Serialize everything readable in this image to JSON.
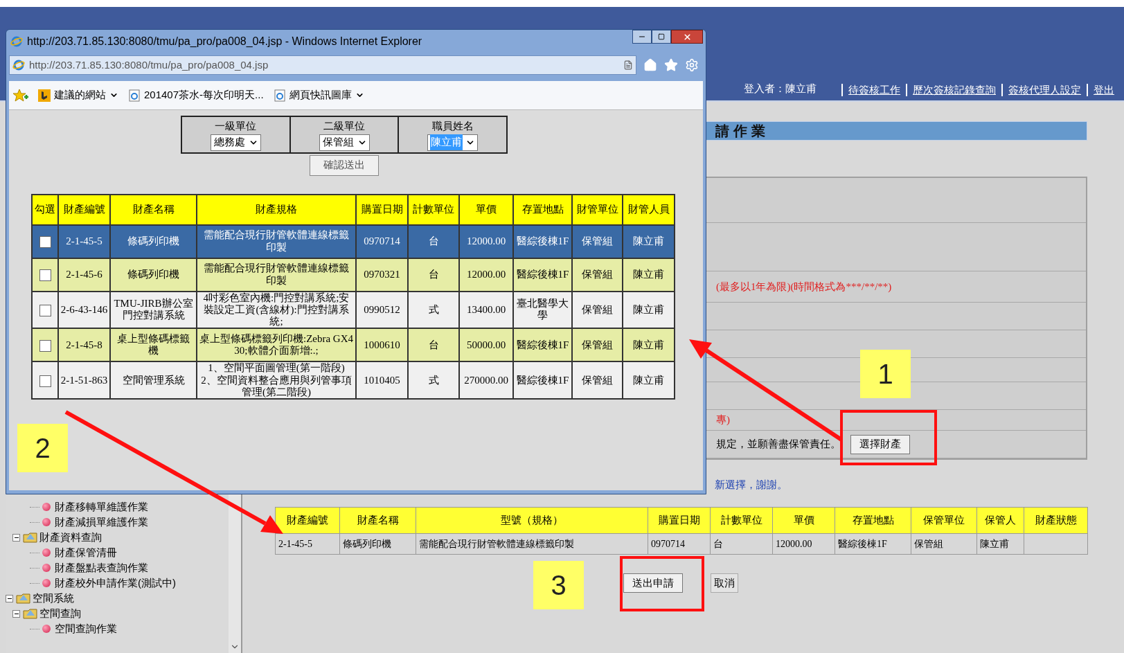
{
  "header": {
    "user_label": "登入者：陳立甫",
    "links": [
      "待簽核工作",
      "歷次簽核記錄查詢",
      "簽核代理人設定",
      "登出"
    ]
  },
  "page_title": "請作業",
  "form_rows": [
    {
      "kind": "blank"
    },
    {
      "kind": "blank"
    },
    {
      "kind": "note",
      "text": "(最多以1年為限)(時間格式為***/**/**)"
    },
    {
      "kind": "blank"
    },
    {
      "kind": "blank"
    },
    {
      "kind": "blank"
    },
    {
      "kind": "blank"
    },
    {
      "kind": "note",
      "text": "專)"
    },
    {
      "kind": "action",
      "text": "規定，並願善盡保管責任。",
      "button": "選擇財產"
    }
  ],
  "notice": "新選擇，謝謝。",
  "selected_table": {
    "columns": [
      "財產編號",
      "財產名稱",
      "型號（規格）",
      "購置日期",
      "計數單位",
      "單價",
      "存置地點",
      "保管單位",
      "保管人",
      "財產狀態"
    ],
    "rows": [
      [
        "2-1-45-5",
        "條碼列印機",
        "需能配合現行財管軟體連線標籤印製",
        "0970714",
        "台",
        "12000.00",
        "醫綜後棟1F",
        "保管組",
        "陳立甫",
        ""
      ]
    ]
  },
  "actions": [
    "送出申請",
    "取消"
  ],
  "sidebar": {
    "tree": [
      {
        "kind": "group",
        "children": [
          {
            "kind": "group",
            "children": [
              {
                "kind": "leaf",
                "label": "財產移轉單維護作業"
              },
              {
                "kind": "leaf",
                "label": "財產減損單維護作業"
              }
            ]
          },
          {
            "kind": "folder",
            "label": "財產資料查詢",
            "expanded": true,
            "children": [
              {
                "kind": "leaf",
                "label": "財產保管清冊"
              },
              {
                "kind": "leaf",
                "label": "財產盤點表查詢作業"
              },
              {
                "kind": "leaf",
                "label": "財產校外申請作業(測試中)"
              }
            ]
          }
        ]
      },
      {
        "kind": "folder",
        "label": "空間系統",
        "expanded": true,
        "children": [
          {
            "kind": "folder",
            "label": "空間查詢",
            "expanded": true,
            "children": [
              {
                "kind": "leaf",
                "label": "空間查詢作業"
              }
            ]
          }
        ]
      }
    ]
  },
  "popup": {
    "title": "http://203.71.85.130:8080/tmu/pa_pro/pa008_04.jsp - Windows Internet Explorer",
    "address": "http://203.71.85.130:8080/tmu/pa_pro/pa008_04.jsp",
    "favorites": [
      {
        "kind": "bing",
        "label": "建議的網站",
        "dropdown": true
      },
      {
        "kind": "page",
        "label": "201407茶水-每次印明天...",
        "dropdown": false
      },
      {
        "kind": "page",
        "label": "網頁快訊圖庫",
        "dropdown": true
      }
    ],
    "filters": [
      {
        "label": "一級單位",
        "value": "總務處",
        "highlighted": false
      },
      {
        "label": "二級單位",
        "value": "保管組",
        "highlighted": false
      },
      {
        "label": "職員姓名",
        "value": "陳立甫",
        "highlighted": true
      }
    ],
    "confirm": "確認送出",
    "table": {
      "checkbox_column": "勾選",
      "columns": [
        "財產編號",
        "財產名稱",
        "財產規格",
        "購置日期",
        "計數單位",
        "單價",
        "存置地點",
        "財管單位",
        "財管人員"
      ],
      "rows": [
        {
          "selected": true,
          "checked": false,
          "cells": [
            "2-1-45-5",
            "條碼列印機",
            "需能配合現行財管軟體連線標籤印製",
            "0970714",
            "台",
            "12000.00",
            "醫綜後棟1F",
            "保管組",
            "陳立甫"
          ]
        },
        {
          "selected": false,
          "checked": false,
          "cells": [
            "2-1-45-6",
            "條碼列印機",
            "需能配合現行財管軟體連線標籤印製",
            "0970321",
            "台",
            "12000.00",
            "醫綜後棟1F",
            "保管組",
            "陳立甫"
          ]
        },
        {
          "selected": false,
          "checked": false,
          "cells": [
            "2-6-43-146",
            "TMU-JIRB辦公室門控對講系統",
            "4吋彩色室內機:門控對講系統;安裝設定工資(含線材):門控對講系統;",
            "0990512",
            "式",
            "13400.00",
            "臺北醫學大學",
            "保管組",
            "陳立甫"
          ]
        },
        {
          "selected": false,
          "checked": false,
          "cells": [
            "2-1-45-8",
            "桌上型條碼標籤機",
            "桌上型條碼標籤列印機:Zebra GX430;軟體介面新增:.;",
            "1000610",
            "台",
            "50000.00",
            "醫綜後棟1F",
            "保管組",
            "陳立甫"
          ]
        },
        {
          "selected": false,
          "checked": false,
          "cells": [
            "2-1-51-863",
            "空間管理系統",
            "1、空間平面圖管理(第一階段)\n2、空間資料整合應用與列管事項管理(第二階段)",
            "1010405",
            "式",
            "270000.00",
            "醫綜後棟1F",
            "保管組",
            "陳立甫"
          ]
        }
      ]
    }
  },
  "annotations": [
    {
      "label": "1"
    },
    {
      "label": "2"
    },
    {
      "label": "3"
    }
  ]
}
